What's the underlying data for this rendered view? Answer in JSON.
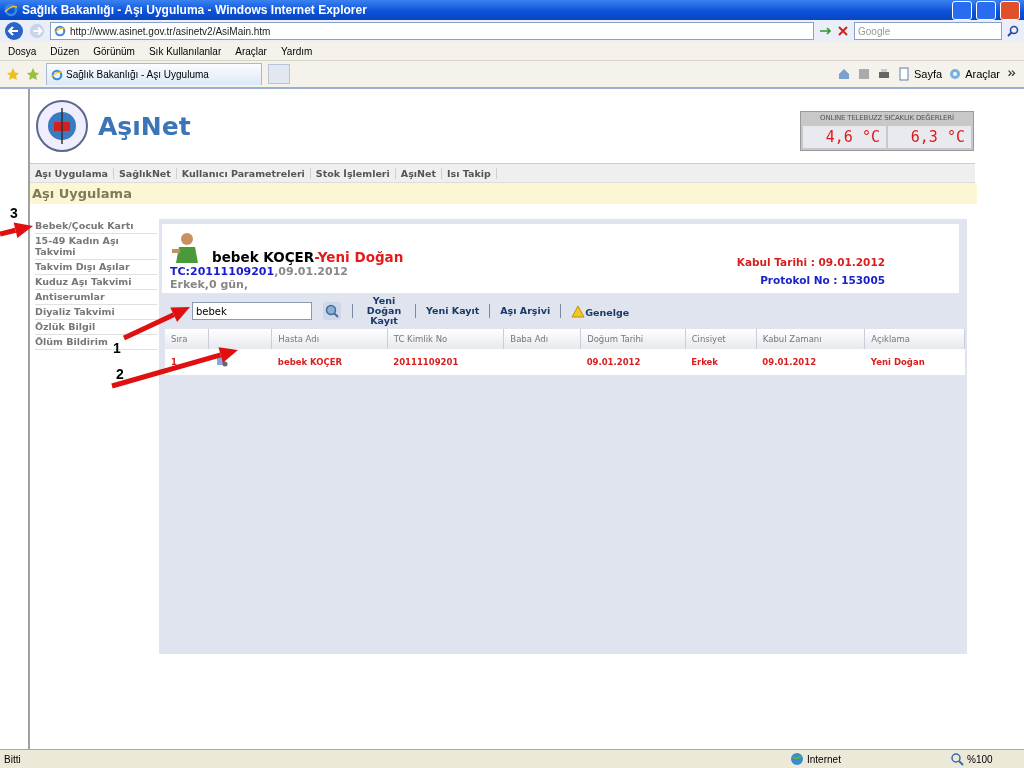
{
  "window": {
    "title": "Sağlık Bakanlığı - Aşı Uyguluma - Windows Internet Explorer"
  },
  "address_bar": {
    "url": "http://www.asinet.gov.tr/asinetv2/AsiMain.htm"
  },
  "search_box": {
    "placeholder": "Google"
  },
  "menu": [
    "Dosya",
    "Düzen",
    "Görünüm",
    "Sık Kullanılanlar",
    "Araçlar",
    "Yardım"
  ],
  "browser_tab": {
    "title": "Sağlık Bakanlığı - Aşı Uyguluma"
  },
  "command_bar": [
    "Sayfa",
    "Araçlar"
  ],
  "page": {
    "logo_text": "AşıNet",
    "temperature_widget": {
      "title": "ONLINE TELEBUZZ SICAKLIK DEĞERLERİ",
      "readings": [
        "4,6 °C",
        "6,3 °C"
      ]
    },
    "nav": [
      "Aşı Uygulama",
      "SağlıkNet",
      "Kullanıcı Parametreleri",
      "Stok İşlemleri",
      "AşıNet",
      "Isı Takip"
    ],
    "section_title": "Aşı Uygulama",
    "sidebar": [
      "Bebek/Çocuk Kartı",
      "15-49 Kadın Aşı Takvimi",
      "Takvim Dışı Aşılar",
      "Kuduz Aşı Takvimi",
      "Antiserumlar",
      "Diyaliz Takvimi",
      "Özlük Bilgil",
      "Ölüm Bildirim"
    ],
    "patient": {
      "name": "bebek KOÇER",
      "status": "-Yeni Doğan",
      "tc": "TC:20111109201",
      "birth_date": ",09.01.2012",
      "details": "Erkek,0 gün,",
      "admission": "Kabul Tarihi : 09.01.2012",
      "protocol": "Protokol No : 153005"
    },
    "search": {
      "value": "bebek"
    },
    "toolbar": [
      {
        "label": "Yeni Doğan Kayıt",
        "kind": "link"
      },
      {
        "label": "Yeni Kayıt",
        "kind": "link"
      },
      {
        "label": "Aşı Arşivi",
        "kind": "link"
      },
      {
        "label": "Genelge",
        "kind": "warning"
      }
    ],
    "table": {
      "columns": [
        "Sıra",
        "Hasta Adı",
        "TC Kimlik No",
        "Baba Adı",
        "Doğum Tarihi",
        "Cinsiyet",
        "Kabul Zamanı",
        "Açıklama"
      ],
      "rows": [
        {
          "sira": "1",
          "hasta_adi": "bebek KOÇER",
          "tc": "20111109201",
          "dogum_tarihi": "09.01.2012",
          "cinsiyet": "Erkek",
          "kabul_zamani": "09.01.2012",
          "aciklama": "Yeni Doğan"
        }
      ]
    }
  },
  "status_bar": {
    "text": "Bitti",
    "zone": "Internet",
    "zoom": "%100"
  },
  "annotations": [
    {
      "label": "3"
    },
    {
      "label": "1"
    },
    {
      "label": "2"
    }
  ]
}
